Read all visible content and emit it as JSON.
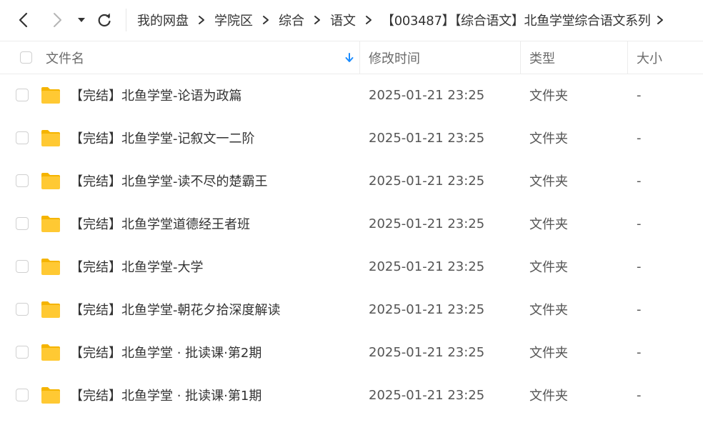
{
  "toolbar": {
    "back_icon": "chevron-left-icon",
    "forward_icon": "chevron-right-icon",
    "history_icon": "caret-down-icon",
    "refresh_icon": "refresh-icon"
  },
  "breadcrumb": [
    "我的网盘",
    "学院区",
    "综合",
    "语文",
    "【003487】【综合语文】北鱼学堂综合语文系列"
  ],
  "header": {
    "name": "文件名",
    "mtime": "修改时间",
    "type": "类型",
    "size": "大小",
    "sort_icon": "sort-down-arrow-icon",
    "sort_color": "#1a8cff"
  },
  "colors": {
    "folder_body": "#ffc933",
    "folder_tab": "#f5b400",
    "border": "#ececec"
  },
  "rows": [
    {
      "name": "【完结】北鱼学堂-论语为政篇",
      "mtime": "2025-01-21 23:25",
      "type": "文件夹",
      "size": "-"
    },
    {
      "name": "【完结】北鱼学堂-记叙文一二阶",
      "mtime": "2025-01-21 23:25",
      "type": "文件夹",
      "size": "-"
    },
    {
      "name": "【完结】北鱼学堂-读不尽的楚霸王",
      "mtime": "2025-01-21 23:25",
      "type": "文件夹",
      "size": "-"
    },
    {
      "name": "【完结】北鱼学堂道德经王者班",
      "mtime": "2025-01-21 23:25",
      "type": "文件夹",
      "size": "-"
    },
    {
      "name": "【完结】北鱼学堂-大学",
      "mtime": "2025-01-21 23:25",
      "type": "文件夹",
      "size": "-"
    },
    {
      "name": "【完结】北鱼学堂-朝花夕拾深度解读",
      "mtime": "2025-01-21 23:25",
      "type": "文件夹",
      "size": "-"
    },
    {
      "name": "【完结】北鱼学堂 · 批读课·第2期",
      "mtime": "2025-01-21 23:25",
      "type": "文件夹",
      "size": "-"
    },
    {
      "name": "【完结】北鱼学堂 · 批读课·第1期",
      "mtime": "2025-01-21 23:25",
      "type": "文件夹",
      "size": "-"
    }
  ]
}
